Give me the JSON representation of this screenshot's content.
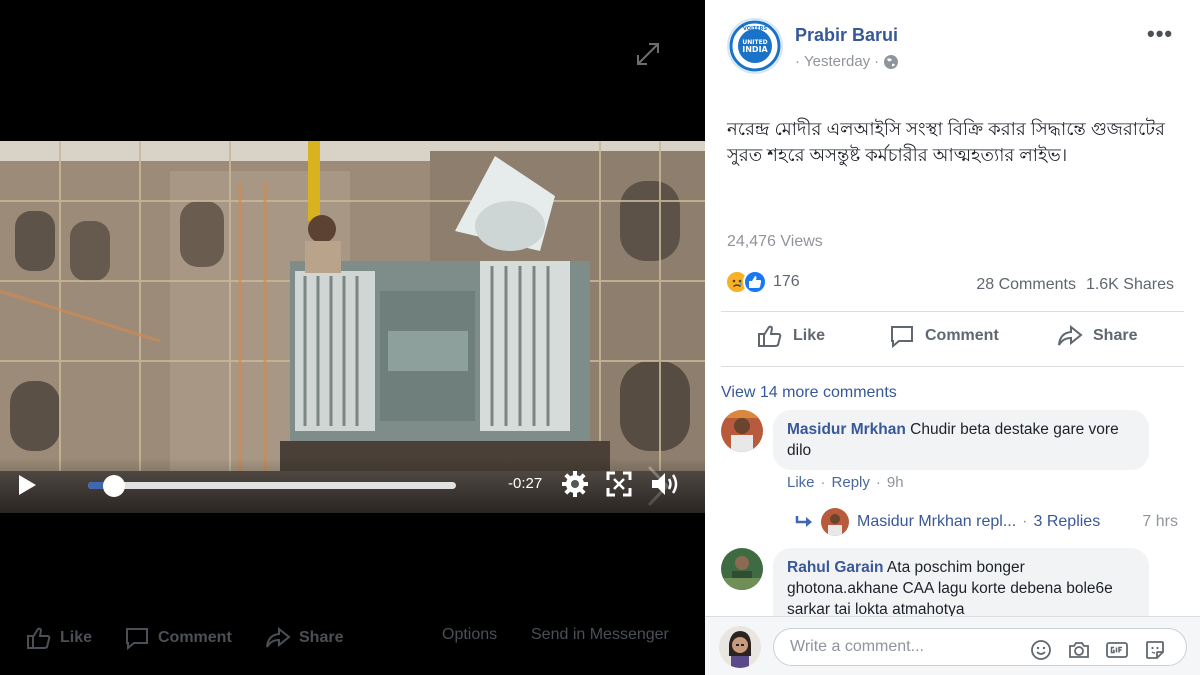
{
  "video": {
    "time_remaining": "-0:27",
    "progress_fraction": 0.07
  },
  "viewer_actions": {
    "like": "Like",
    "comment": "Comment",
    "share": "Share",
    "options": "Options",
    "send_messenger": "Send in Messenger"
  },
  "post": {
    "page_name": "Prabir Barui",
    "timestamp": "Yesterday",
    "text": "নরেন্দ্র মোদীর এলআইসি সংস্থা বিক্রি করার সিদ্ধান্তে গুজরাটের সুরত শহরে অসন্তুষ্ট কর্মচারীর আত্মহত্যার লাইভ।",
    "views": "24,476 Views",
    "reaction_count": "176",
    "comments_count": "28 Comments",
    "shares_count": "1.6K Shares",
    "logo_text_top": "VOITERS",
    "logo_text_mid1": "UNITED",
    "logo_text_mid2": "INDIA"
  },
  "actions": {
    "like": "Like",
    "comment": "Comment",
    "share": "Share"
  },
  "comments": {
    "view_more": "View 14 more comments",
    "items": [
      {
        "author": "Masidur Mrkhan",
        "text": "Chudir beta destake gare vore dilo",
        "like": "Like",
        "reply": "Reply",
        "time": "9h"
      },
      {
        "author": "Rahul Garain",
        "text": "Ata poschim bonger ghotona.akhane CAA lagu korte debena bole6e sarkar tai lokta atmahotya"
      }
    ],
    "reply_summary": {
      "author": "Masidur Mrkhan repl...",
      "replies": "3 Replies",
      "time": "7 hrs"
    }
  },
  "composer": {
    "placeholder": "Write a comment..."
  },
  "colors": {
    "brand_blue": "#4267b2",
    "link_blue": "#365899",
    "like_blue": "#1877f2"
  },
  "icons": [
    "expand-icon",
    "play-icon",
    "settings-gear-icon",
    "fullscreen-icon",
    "volume-icon",
    "globe-icon",
    "more-dots-icon",
    "like-icon",
    "comment-icon",
    "share-icon",
    "reply-arrow-icon",
    "emoji-icon",
    "camera-icon",
    "gif-icon",
    "sticker-icon"
  ]
}
